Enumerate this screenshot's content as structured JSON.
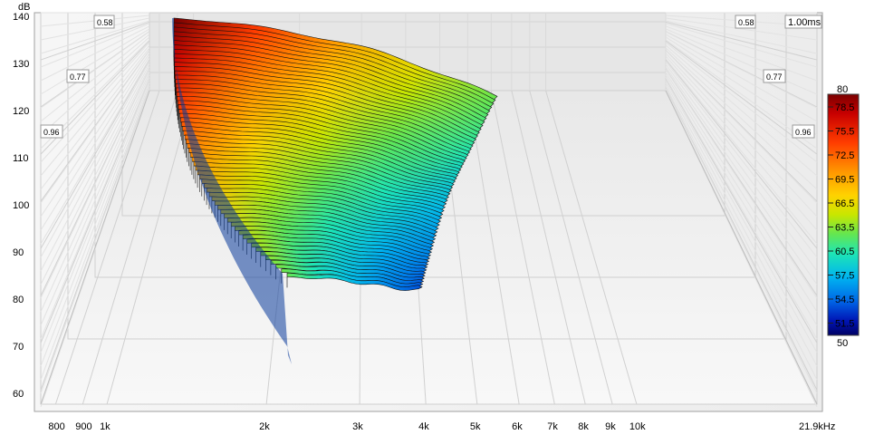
{
  "chart_data": {
    "type": "waterfall-3d",
    "y_unit": "dB",
    "y_ticks": [
      "140",
      "130",
      "120",
      "110",
      "100",
      "90",
      "80",
      "70",
      "60"
    ],
    "ylim": [
      57,
      140
    ],
    "x_unit": "Hz",
    "x_ticks": [
      {
        "v": 800,
        "label": "800"
      },
      {
        "v": 900,
        "label": "900"
      },
      {
        "v": 1000,
        "label": "1k"
      },
      {
        "v": 2000,
        "label": "2k"
      },
      {
        "v": 3000,
        "label": "3k"
      },
      {
        "v": 4000,
        "label": "4k"
      },
      {
        "v": 5000,
        "label": "5k"
      },
      {
        "v": 6000,
        "label": "6k"
      },
      {
        "v": 7000,
        "label": "7k"
      },
      {
        "v": 8000,
        "label": "8k"
      },
      {
        "v": 9000,
        "label": "9k"
      },
      {
        "v": 10000,
        "label": "10k"
      },
      {
        "v": 21900,
        "label": "21.9kHz"
      }
    ],
    "xlim": [
      750,
      21900
    ],
    "time_unit": "ms",
    "time_labels_left": [
      "0.58",
      "0.77",
      "0.96"
    ],
    "time_labels_right": [
      "1.00ms",
      "0.58",
      "0.77",
      "0.96"
    ],
    "time_range": [
      0,
      1.0
    ],
    "colorbar": {
      "min": "50",
      "max": "80",
      "ticks": [
        "78.5",
        "75.5",
        "72.5",
        "69.5",
        "66.5",
        "63.5",
        "60.5",
        "57.5",
        "54.5",
        "51.5"
      ]
    },
    "slices": 60,
    "front_slice_top_db": [
      [
        1.36,
        130
      ],
      [
        1.5,
        126
      ],
      [
        1.7,
        120
      ],
      [
        2.0,
        114
      ],
      [
        2.3,
        109
      ],
      [
        2.8,
        104
      ],
      [
        3.3,
        100
      ],
      [
        3.8,
        96
      ],
      [
        4.1,
        93
      ],
      [
        4.3,
        91
      ],
      [
        4.5,
        89
      ]
    ],
    "front_slice_bottom_db": [
      [
        1.36,
        92
      ],
      [
        1.7,
        82
      ],
      [
        2.0,
        76
      ],
      [
        2.4,
        70
      ],
      [
        2.8,
        67
      ],
      [
        3.3,
        66
      ],
      [
        4.3,
        70
      ],
      [
        4.5,
        76
      ]
    ],
    "back_slice_top_db": [
      [
        1.36,
        140
      ],
      [
        2.0,
        139
      ],
      [
        2.8,
        137
      ],
      [
        3.6,
        132
      ],
      [
        4.5,
        127
      ],
      [
        5.5,
        122
      ]
    ],
    "back_slice_bottom_db": [
      [
        1.36,
        140
      ],
      [
        1.6,
        139
      ],
      [
        2.2,
        136
      ],
      [
        3.0,
        132
      ],
      [
        4.0,
        127
      ],
      [
        5.5,
        122
      ]
    ]
  }
}
